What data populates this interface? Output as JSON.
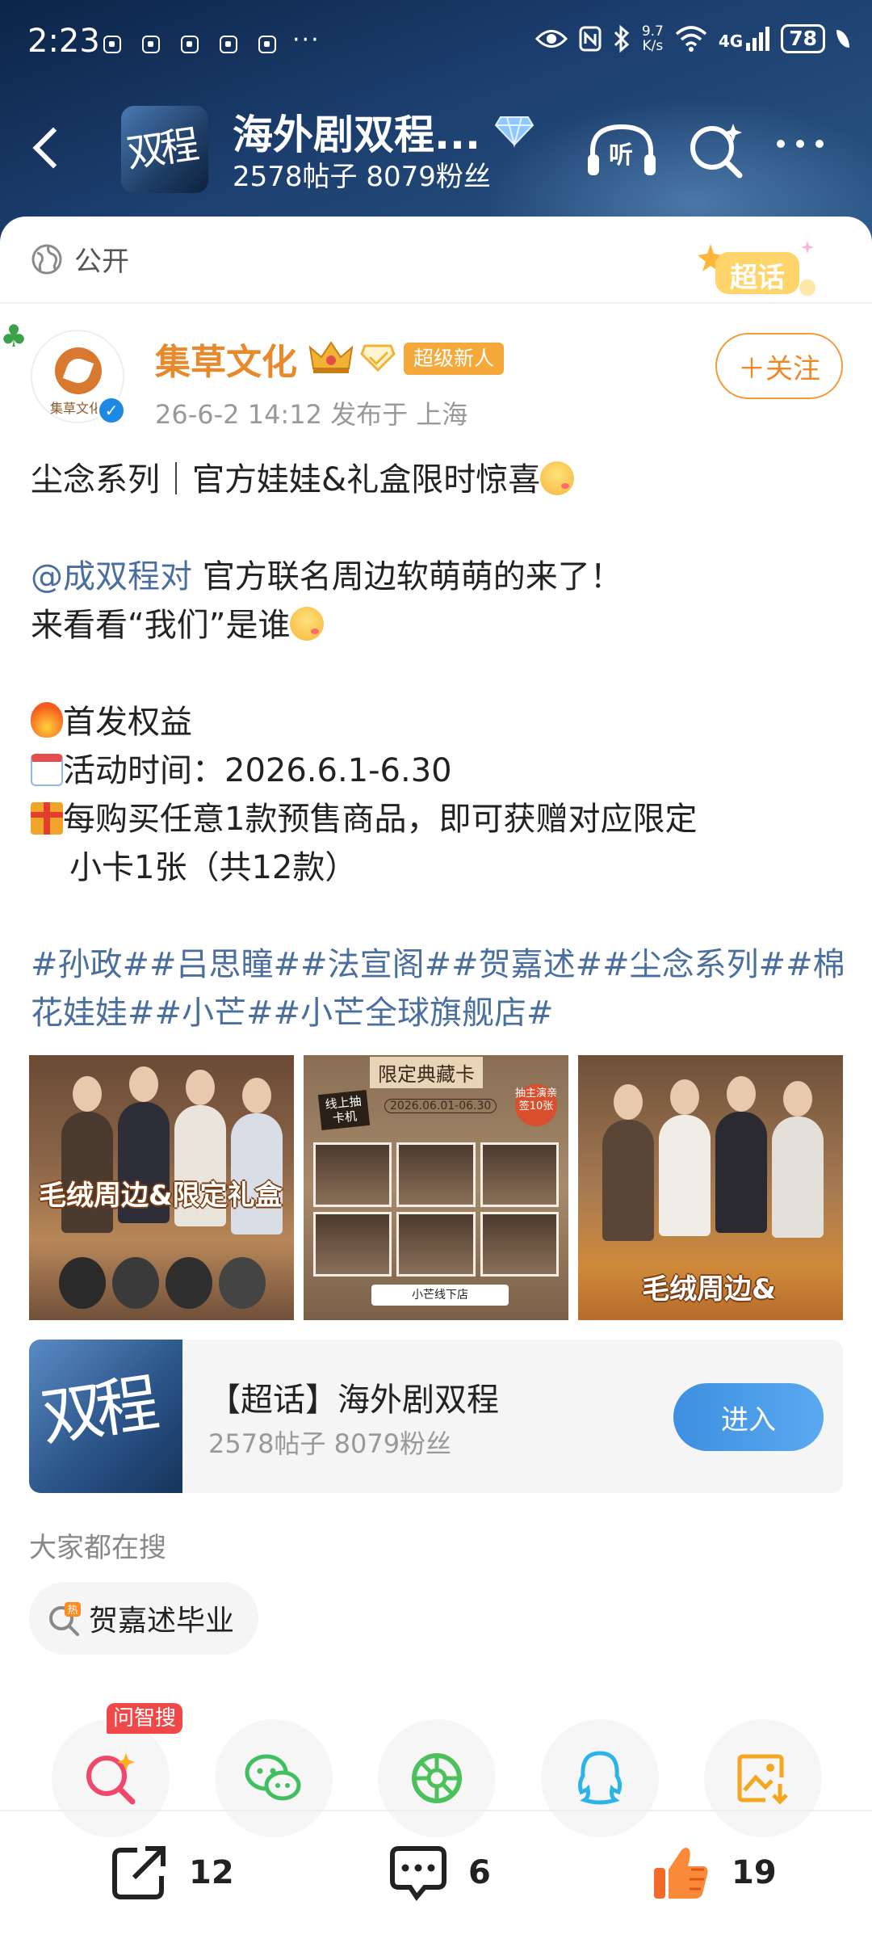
{
  "status_bar": {
    "time": "2:23",
    "dots": "···",
    "net_speed_value": "9.7",
    "net_speed_unit": "K/s",
    "signal_label": "4G",
    "battery": "78"
  },
  "nav": {
    "thumb_text": "双程",
    "title": "海外剧双程...",
    "stats": "2578帖子 8079粉丝",
    "listen_label": "听"
  },
  "visibility": {
    "label": "公开"
  },
  "supertopic_badge": "超话",
  "author": {
    "name": "集草文化",
    "avatar_text": "集草文化",
    "badge_new": "超级新人",
    "meta": "26-6-2 14:12  发布于 上海",
    "follow_label": "＋关注"
  },
  "post": {
    "line1": "尘念系列｜官方娃娃&礼盒限时惊喜",
    "mention": "@成双程对",
    "line2_rest": " 官方联名周边软萌萌的来了！",
    "line3": "来看看“我们”是谁",
    "line4": "首发权益",
    "line5": "活动时间：2026.6.1-6.30",
    "line6": "每购买任意1款预售商品，即可获赠对应限定",
    "line7": "小卡1张（共12款）",
    "hashtags": "#孙政##吕思瞳##法宣阁##贺嘉述##尘念系列##棉花娃娃##小芒##小芒全球旗舰店#"
  },
  "images": {
    "img1_caption": "毛绒周边&限定礼盒",
    "img2_title": "限定典藏卡",
    "img2_date": "2026.06.01-06.30",
    "img2_tag": "线上抽卡机",
    "img2_stamp": "抽主演亲签10张",
    "img2_store": "小芒线下店",
    "img3_caption": "毛绒周边&"
  },
  "topic_card": {
    "thumb_text": "双程",
    "title": "【超话】海外剧双程",
    "stats": "2578帖子 8079粉丝",
    "enter_label": "进入"
  },
  "search": {
    "title": "大家都在搜",
    "hot_item": "贺嘉述毕业"
  },
  "share": {
    "wenzhi_label": "问智搜"
  },
  "actions": {
    "repost_count": "12",
    "comment_count": "6",
    "like_count": "19"
  },
  "colors": {
    "header_bg": "#1c3e6e",
    "author_name": "#e8892b",
    "link": "#4a6f9e",
    "enter_button": "#3d8fe0",
    "like": "#f46a2a"
  }
}
